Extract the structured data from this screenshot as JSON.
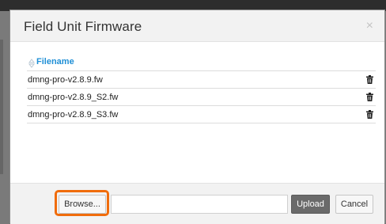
{
  "dialog": {
    "title": "Field Unit Firmware",
    "close_symbol": "×"
  },
  "table": {
    "column_header": "Filename",
    "sort_icon": "sort-icon",
    "delete_icon": "trash-icon",
    "rows": [
      {
        "filename": "dmng-pro-v2.8.9.fw"
      },
      {
        "filename": "dmng-pro-v2.8.9_S2.fw"
      },
      {
        "filename": "dmng-pro-v2.8.9_S3.fw"
      }
    ]
  },
  "footer": {
    "browse_label": "Browse...",
    "file_value": "",
    "upload_label": "Upload",
    "cancel_label": "Cancel"
  },
  "colors": {
    "accent": "#1f8fd6",
    "highlight": "#f06c0c",
    "primary_button": "#6a6a6a"
  }
}
